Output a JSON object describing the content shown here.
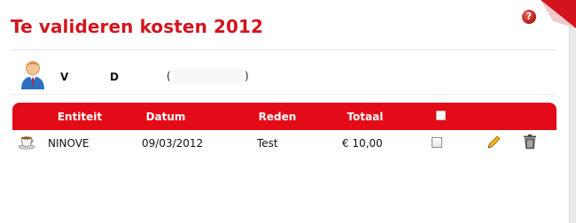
{
  "panel": {
    "title": "Te valideren kosten 2012",
    "help_label": "?"
  },
  "user": {
    "first": "V",
    "last": "D",
    "paren_open": "(",
    "paren_close": ")"
  },
  "table": {
    "columns": [
      "Entiteit",
      "Datum",
      "Reden",
      "Totaal"
    ],
    "rows": [
      {
        "entiteit": "NINOVE",
        "datum": "09/03/2012",
        "reden": "Test",
        "totaal": "€ 10,00"
      }
    ]
  },
  "colors": {
    "accent": "#d3141f",
    "header_bg": "#e30b17"
  },
  "icons": {
    "help": "help-icon",
    "corner": "page-curl-icon",
    "user": "user-avatar-icon",
    "row": "coffee-cup-icon",
    "edit": "pencil-icon",
    "delete": "trash-icon"
  }
}
